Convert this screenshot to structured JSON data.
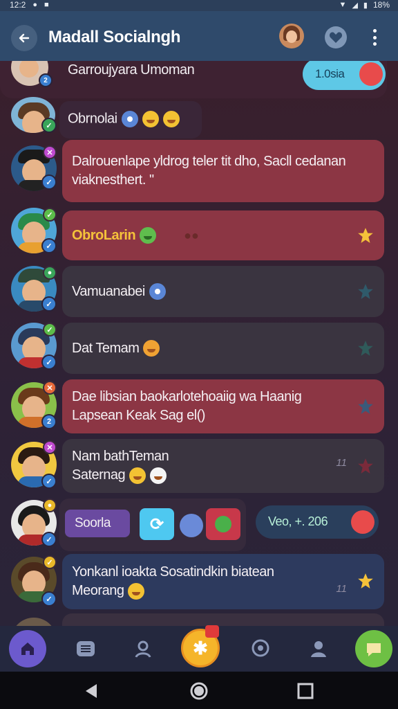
{
  "status_bar": {
    "time": "12:2",
    "battery": "18%"
  },
  "app_bar": {
    "title": "Madall Socialngh"
  },
  "top_card": {
    "text": "Garroujyara Umoman",
    "pill_label": "1.0sia"
  },
  "chats": [
    {
      "text": "Obrnolai"
    },
    {
      "text": "Dalrouenlape yldrog teler tit dho, Sacll cedanan viaknesthert. \""
    },
    {
      "text": "ObroLarin"
    },
    {
      "text": "Vamuanabei"
    },
    {
      "text": "Dat Temam"
    },
    {
      "text": "Dae libsian baokarlotehoaiig wa Haanig Lapsean Keak Sag el()"
    },
    {
      "text": "Nam bathTeman Saternag",
      "count": "11"
    },
    {
      "text": "Yonkanl ioakta Sosatindkin biatean Meorang",
      "count": "11"
    }
  ],
  "tag_row": {
    "tag": "Soorla",
    "pill_label": "Veo, +. 206"
  },
  "bottom_nav": {
    "items": [
      "home",
      "list",
      "contacts",
      "favorites",
      "chat",
      "profile",
      "more"
    ]
  },
  "colors": {
    "accent_red": "#8c3644",
    "accent_blue": "#2f4a6b",
    "nav_home": "#6c5acd",
    "nav_center": "#f5b52a",
    "nav_right": "#6ec044"
  }
}
